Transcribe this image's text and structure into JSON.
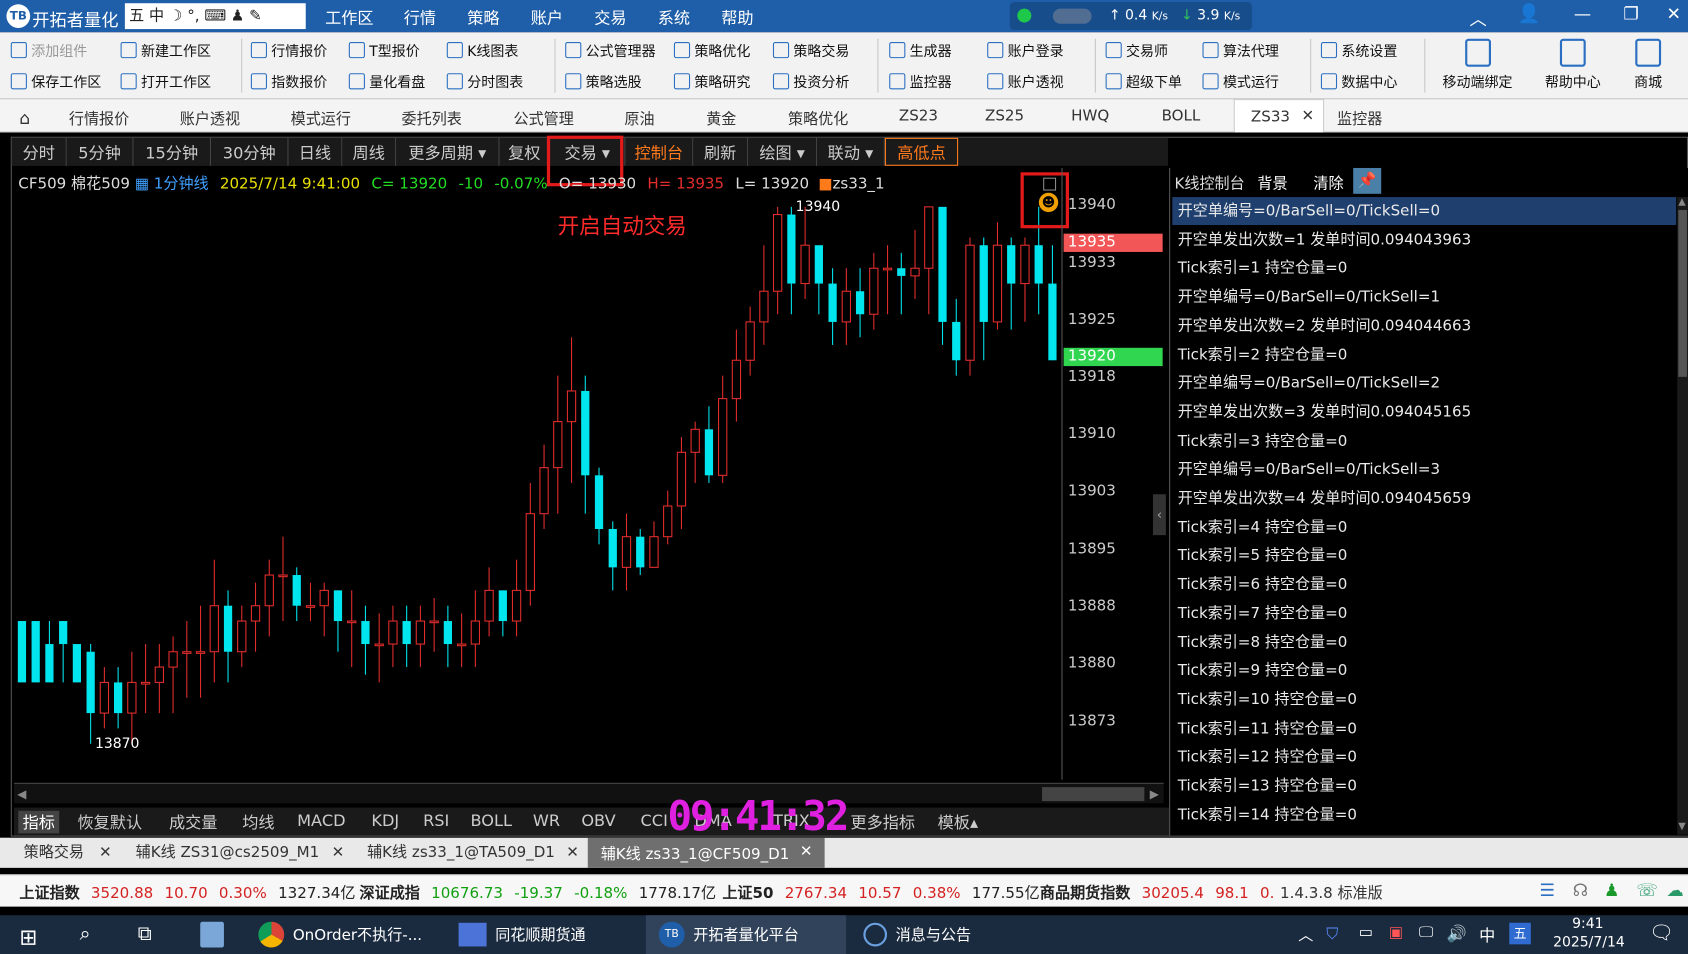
{
  "app": {
    "title": "开拓者量化",
    "ime": "五 中",
    "menu": [
      "工作区",
      "行情",
      "策略",
      "账户",
      "交易",
      "系统",
      "帮助"
    ],
    "net_speed_up": "0.4",
    "net_speed_down": "3.9",
    "speed_unit": "K/s"
  },
  "toolbar": {
    "row1": [
      "添加组件",
      "新建工作区",
      "行情报价",
      "T型报价",
      "K线图表",
      "公式管理器",
      "策略优化",
      "策略交易",
      "生成器",
      "账户登录",
      "交易师",
      "算法代理",
      "系统设置"
    ],
    "row2": [
      "保存工作区",
      "打开工作区",
      "指数报价",
      "量化看盘",
      "分时图表",
      "策略选股",
      "策略研究",
      "投资分析",
      "监控器",
      "账户透视",
      "超级下单",
      "模式运行",
      "数据中心"
    ],
    "big": [
      "移动端绑定",
      "帮助中心",
      "商城"
    ]
  },
  "tabs": [
    "行情报价",
    "账户透视",
    "模式运行",
    "委托列表",
    "公式管理",
    "原油",
    "黄金",
    "策略优化",
    "ZS23",
    "ZS25",
    "HWQ",
    "BOLL",
    "ZS33",
    "监控器"
  ],
  "active_tab": "ZS33",
  "chart_toolbar": [
    "分时",
    "5分钟",
    "15分钟",
    "30分钟",
    "日线",
    "周线",
    "更多周期 ▾",
    "复权",
    "交易 ▾",
    "控制台",
    "刷新",
    "绘图 ▾",
    "联动 ▾",
    "高低点"
  ],
  "header": {
    "symbol": "CF509 棉花509",
    "period": "1分钟线",
    "datetime": "2025/7/14 9:41:00",
    "close": "C= 13920",
    "change": "-10",
    "change_pct": "-0.07%",
    "open": "O= 13930",
    "high": "H= 13935",
    "low": "L= 13920",
    "strategy": "zs33_1"
  },
  "annotation": "开启自动交易",
  "price_axis": [
    "13940",
    "13933",
    "13925",
    "13918",
    "13910",
    "13903",
    "13895",
    "13888",
    "13880",
    "13873"
  ],
  "price_tags": {
    "high": "13935",
    "last": "13920"
  },
  "chart_labels": {
    "max": "13940",
    "min": "13870"
  },
  "candles": [
    [
      13886,
      13878,
      13883,
      13886
    ],
    [
      13886,
      13878,
      13883,
      13886
    ],
    [
      13883,
      13878,
      13886,
      13883
    ],
    [
      13886,
      13883,
      13886,
      13878
    ],
    [
      13883,
      13878,
      13883,
      13882
    ],
    [
      13882,
      13874,
      13883,
      13870
    ],
    [
      13874,
      13878,
      13880,
      13872
    ],
    [
      13878,
      13874,
      13880,
      13872
    ],
    [
      13874,
      13878,
      13882,
      13870
    ],
    [
      13878,
      13878,
      13883,
      13874
    ],
    [
      13878,
      13880,
      13883,
      13874
    ],
    [
      13880,
      13882,
      13884,
      13874
    ],
    [
      13882,
      13882,
      13886,
      13876
    ],
    [
      13882,
      13882,
      13888,
      13876
    ],
    [
      13882,
      13888,
      13894,
      13878
    ],
    [
      13888,
      13882,
      13890,
      13878
    ],
    [
      13882,
      13886,
      13888,
      13880
    ],
    [
      13886,
      13888,
      13891,
      13882
    ],
    [
      13888,
      13892,
      13894,
      13884
    ],
    [
      13892,
      13892,
      13897,
      13886
    ],
    [
      13892,
      13888,
      13893,
      13886
    ],
    [
      13888,
      13888,
      13891,
      13886
    ],
    [
      13888,
      13890,
      13891,
      13884
    ],
    [
      13890,
      13886,
      13890,
      13882
    ],
    [
      13886,
      13886,
      13890,
      13880
    ],
    [
      13886,
      13883,
      13888,
      13879
    ],
    [
      13883,
      13883,
      13887,
      13878
    ],
    [
      13883,
      13886,
      13888,
      13880
    ],
    [
      13886,
      13883,
      13888,
      13880
    ],
    [
      13883,
      13886,
      13888,
      13880
    ],
    [
      13886,
      13886,
      13889,
      13882
    ],
    [
      13886,
      13883,
      13888,
      13880
    ],
    [
      13883,
      13883,
      13887,
      13880
    ],
    [
      13883,
      13886,
      13890,
      13880
    ],
    [
      13886,
      13890,
      13893,
      13884
    ],
    [
      13890,
      13886,
      13890,
      13884
    ],
    [
      13886,
      13890,
      13894,
      13884
    ],
    [
      13890,
      13900,
      13904,
      13888
    ],
    [
      13900,
      13906,
      13909,
      13898
    ],
    [
      13906,
      13912,
      13918,
      13900
    ],
    [
      13912,
      13916,
      13923,
      13904
    ],
    [
      13916,
      13905,
      13918,
      13900
    ],
    [
      13905,
      13898,
      13906,
      13896
    ],
    [
      13898,
      13893,
      13899,
      13890
    ],
    [
      13893,
      13897,
      13900,
      13890
    ],
    [
      13897,
      13893,
      13898,
      13892
    ],
    [
      13893,
      13897,
      13899,
      13894
    ],
    [
      13897,
      13901,
      13903,
      13896
    ],
    [
      13901,
      13908,
      13910,
      13898
    ],
    [
      13908,
      13911,
      13912,
      13904
    ],
    [
      13911,
      13905,
      13914,
      13904
    ],
    [
      13905,
      13915,
      13918,
      13904
    ],
    [
      13915,
      13920,
      13924,
      13912
    ],
    [
      13920,
      13925,
      13927,
      13918
    ],
    [
      13925,
      13929,
      13935,
      13922
    ],
    [
      13929,
      13939,
      13940,
      13926
    ],
    [
      13939,
      13930,
      13940,
      13926
    ],
    [
      13930,
      13935,
      13940,
      13928
    ],
    [
      13935,
      13930,
      13934,
      13926
    ],
    [
      13930,
      13925,
      13932,
      13922
    ],
    [
      13925,
      13929,
      13932,
      13922
    ],
    [
      13929,
      13926,
      13932,
      13923
    ],
    [
      13926,
      13932,
      13934,
      13924
    ],
    [
      13932,
      13932,
      13935,
      13926
    ],
    [
      13932,
      13931,
      13934,
      13926
    ],
    [
      13931,
      13932,
      13937,
      13928
    ],
    [
      13932,
      13940,
      13940,
      13926
    ],
    [
      13940,
      13925,
      13940,
      13922
    ],
    [
      13925,
      13920,
      13928,
      13918
    ],
    [
      13920,
      13935,
      13936,
      13918
    ],
    [
      13935,
      13925,
      13936,
      13920
    ],
    [
      13925,
      13935,
      13938,
      13924
    ],
    [
      13935,
      13930,
      13936,
      13924
    ],
    [
      13930,
      13935,
      13936,
      13925
    ],
    [
      13935,
      13930,
      13940,
      13926
    ],
    [
      13930,
      13920,
      13935,
      13920
    ]
  ],
  "right_panel": {
    "title": "K线控制台",
    "btn_bg": "背景",
    "btn_clear": "清除",
    "logs": [
      "开空单编号=0/BarSell=0/TickSell=0",
      "开空单发出次数=1  发单时间0.094043963",
      "Tick索引=1  持空仓量=0",
      "开空单编号=0/BarSell=0/TickSell=1",
      "开空单发出次数=2  发单时间0.094044663",
      "Tick索引=2  持空仓量=0",
      "开空单编号=0/BarSell=0/TickSell=2",
      "开空单发出次数=3  发单时间0.094045165",
      "Tick索引=3  持空仓量=0",
      "开空单编号=0/BarSell=0/TickSell=3",
      "开空单发出次数=4  发单时间0.094045659",
      "Tick索引=4  持空仓量=0",
      "Tick索引=5  持空仓量=0",
      "Tick索引=6  持空仓量=0",
      "Tick索引=7  持空仓量=0",
      "Tick索引=8  持空仓量=0",
      "Tick索引=9  持空仓量=0",
      "Tick索引=10  持空仓量=0",
      "Tick索引=11  持空仓量=0",
      "Tick索引=12  持空仓量=0",
      "Tick索引=13  持空仓量=0",
      "Tick索引=14  持空仓量=0"
    ]
  },
  "indicator_bar": [
    "指标",
    "恢复默认",
    "成交量",
    "均线",
    "MACD",
    "KDJ",
    "RSI",
    "BOLL",
    "WR",
    "OBV",
    "CCI",
    "DMA",
    "TRIX",
    "更多指标",
    "模板▴"
  ],
  "clock_overlay": "09:41:32",
  "subtabs": [
    "策略交易",
    "辅K线 ZS31@cs2509_M1",
    "辅K线 zs33_1@TA509_D1",
    "辅K线 zs33_1@CF509_D1"
  ],
  "ticker": [
    {
      "name": "上证指数",
      "price": "3520.88",
      "chg": "10.70",
      "pct": "0.30%",
      "amt": "1327.34亿"
    },
    {
      "name": "深证成指",
      "price": "10676.73",
      "chg": "-19.37",
      "pct": "-0.18%",
      "amt": "1778.17亿"
    },
    {
      "name": "上证50",
      "price": "2767.34",
      "chg": "10.57",
      "pct": "0.38%",
      "amt": "177.55亿"
    },
    {
      "name": "商品期货指数",
      "price": "30205.4",
      "chg": "98.1",
      "pct": "0.",
      "amt": ""
    }
  ],
  "version": "1.4.3.8 标准版",
  "taskbar": {
    "apps": [
      "OnOrder不执行-...",
      "同花顺期货通",
      "开拓者量化平台",
      "消息与公告"
    ],
    "time": "9:41",
    "date": "2025/7/14",
    "ime": "中"
  },
  "colors": {
    "up": "#e32d2d",
    "down": "#00e5ee",
    "accent": "#1f5ea8"
  }
}
